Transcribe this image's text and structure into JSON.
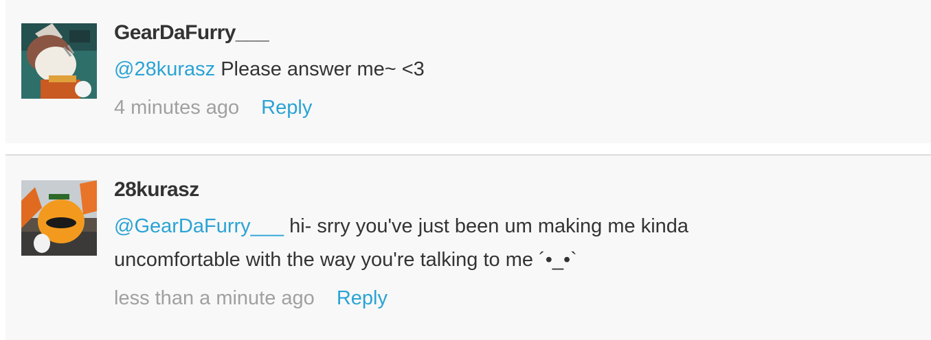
{
  "comments": [
    {
      "username": "GearDaFurry___",
      "mention": "@28kurasz",
      "text": "Please answer me~ <3",
      "time": "4 minutes ago",
      "reply_label": "Reply"
    },
    {
      "username": "28kurasz",
      "mention": "@GearDaFurry___",
      "text": "hi- srry you've just been um making me kinda uncomfortable with the way you're talking to me ´•_•`",
      "time": "less than a minute ago",
      "reply_label": "Reply"
    }
  ],
  "colors": {
    "link": "#2aa3d5",
    "text": "#333333",
    "muted": "#a0a0a0",
    "card_background": "#f8f8f8",
    "divider": "#dcdcdc"
  }
}
